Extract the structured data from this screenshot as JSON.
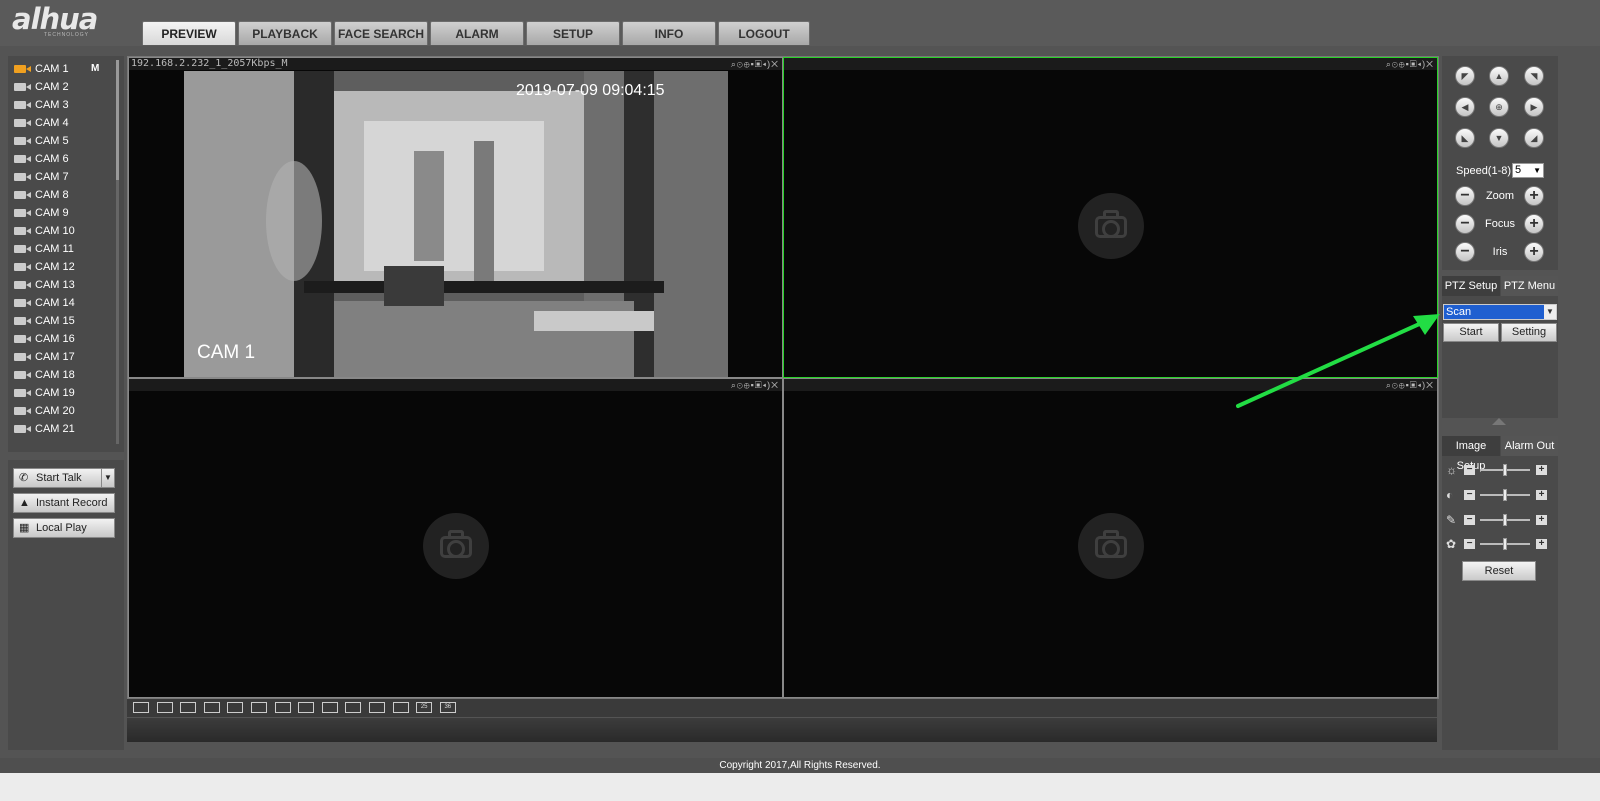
{
  "brand": {
    "logo": "alhua",
    "tagline": "TECHNOLOGY"
  },
  "nav": {
    "tabs": [
      "PREVIEW",
      "PLAYBACK",
      "FACE SEARCH",
      "ALARM",
      "SETUP",
      "INFO",
      "LOGOUT"
    ],
    "active": "PREVIEW"
  },
  "channels": {
    "items": [
      "CAM 1",
      "CAM 2",
      "CAM 3",
      "CAM 4",
      "CAM 5",
      "CAM 6",
      "CAM 7",
      "CAM 8",
      "CAM 9",
      "CAM 10",
      "CAM 11",
      "CAM 12",
      "CAM 13",
      "CAM 14",
      "CAM 15",
      "CAM 16",
      "CAM 17",
      "CAM 18",
      "CAM 19",
      "CAM 20",
      "CAM 21"
    ],
    "active_stream_mark": "M"
  },
  "actions": {
    "start_talk": "Start Talk",
    "instant_record": "Instant Record",
    "local_play": "Local Play"
  },
  "video": {
    "pane1_title": "192.168.2.232_1_2057Kbps_M",
    "timestamp": "2019-07-09 09:04:15",
    "osd_name": "CAM 1"
  },
  "layouts": [
    "1x1",
    "2x2",
    "full",
    "fit",
    "1",
    "4",
    "6",
    "8",
    "9",
    "13",
    "16",
    "20",
    "25",
    "36"
  ],
  "ptz": {
    "speed_label": "Speed(1-8):",
    "speed_value": "5",
    "zoom_label": "Zoom",
    "focus_label": "Focus",
    "iris_label": "Iris",
    "tab_setup": "PTZ Setup",
    "tab_menu": "PTZ Menu",
    "mode_value": "Scan",
    "start_label": "Start",
    "setting_label": "Setting"
  },
  "image_setup": {
    "tab_image": "Image Setup",
    "tab_alarm": "Alarm Out",
    "brightness": 0.5,
    "contrast": 0.5,
    "saturation": 0.5,
    "hue": 0.5,
    "reset_label": "Reset"
  },
  "footer": {
    "copyright": "Copyright 2017,All Rights Reserved."
  },
  "annotation": {
    "arrow_color": "#22dd44"
  }
}
